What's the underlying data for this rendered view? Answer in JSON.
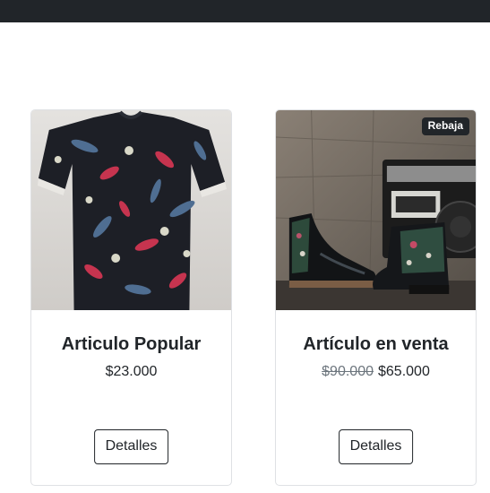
{
  "products": [
    {
      "title": "Articulo Popular",
      "price": "$23.000",
      "details_label": "Detalles"
    },
    {
      "title": "Artículo en venta",
      "badge": "Rebaja",
      "old_price": "$90.000",
      "price": "$65.000",
      "details_label": "Detalles"
    }
  ],
  "colors": {
    "navbar": "#212529",
    "badge": "#212529",
    "muted_price": "#6c757d",
    "card_border": "#dfe1e4"
  }
}
